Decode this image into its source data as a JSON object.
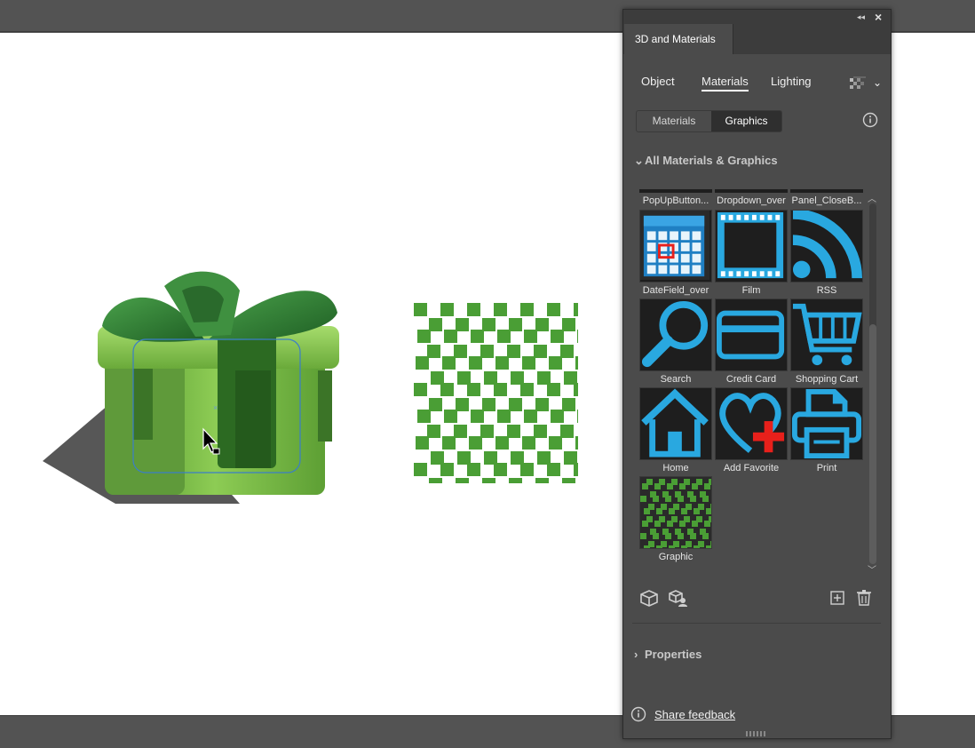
{
  "panel": {
    "title": "3D and Materials",
    "tabs": [
      "Object",
      "Materials",
      "Lighting"
    ],
    "active_tab": "Materials",
    "segmented": {
      "materials_label": "Materials",
      "graphics_label": "Graphics",
      "selected": "Graphics"
    },
    "section_title": "All Materials & Graphics",
    "top_row_labels": [
      "PopUpButton...",
      "Dropdown_over",
      "Panel_CloseB..."
    ],
    "tiles": [
      {
        "label": "DateField_over",
        "icon": "calendar-icon"
      },
      {
        "label": "Film",
        "icon": "film-icon"
      },
      {
        "label": "RSS",
        "icon": "rss-icon"
      },
      {
        "label": "Search",
        "icon": "search-icon"
      },
      {
        "label": "Credit Card",
        "icon": "credit-card-icon"
      },
      {
        "label": "Shopping Cart",
        "icon": "shopping-cart-icon"
      },
      {
        "label": "Home",
        "icon": "home-icon"
      },
      {
        "label": "Add Favorite",
        "icon": "heart-add-icon"
      },
      {
        "label": "Print",
        "icon": "printer-icon"
      },
      {
        "label": "Graphic",
        "icon": "pattern-icon"
      }
    ],
    "properties_label": "Properties",
    "feedback_label": "Share feedback"
  },
  "colors": {
    "accent_blue": "#29a8e0",
    "gift_green": "#5aa832",
    "pattern_green": "#4a9e35",
    "add_red": "#e8201b"
  }
}
